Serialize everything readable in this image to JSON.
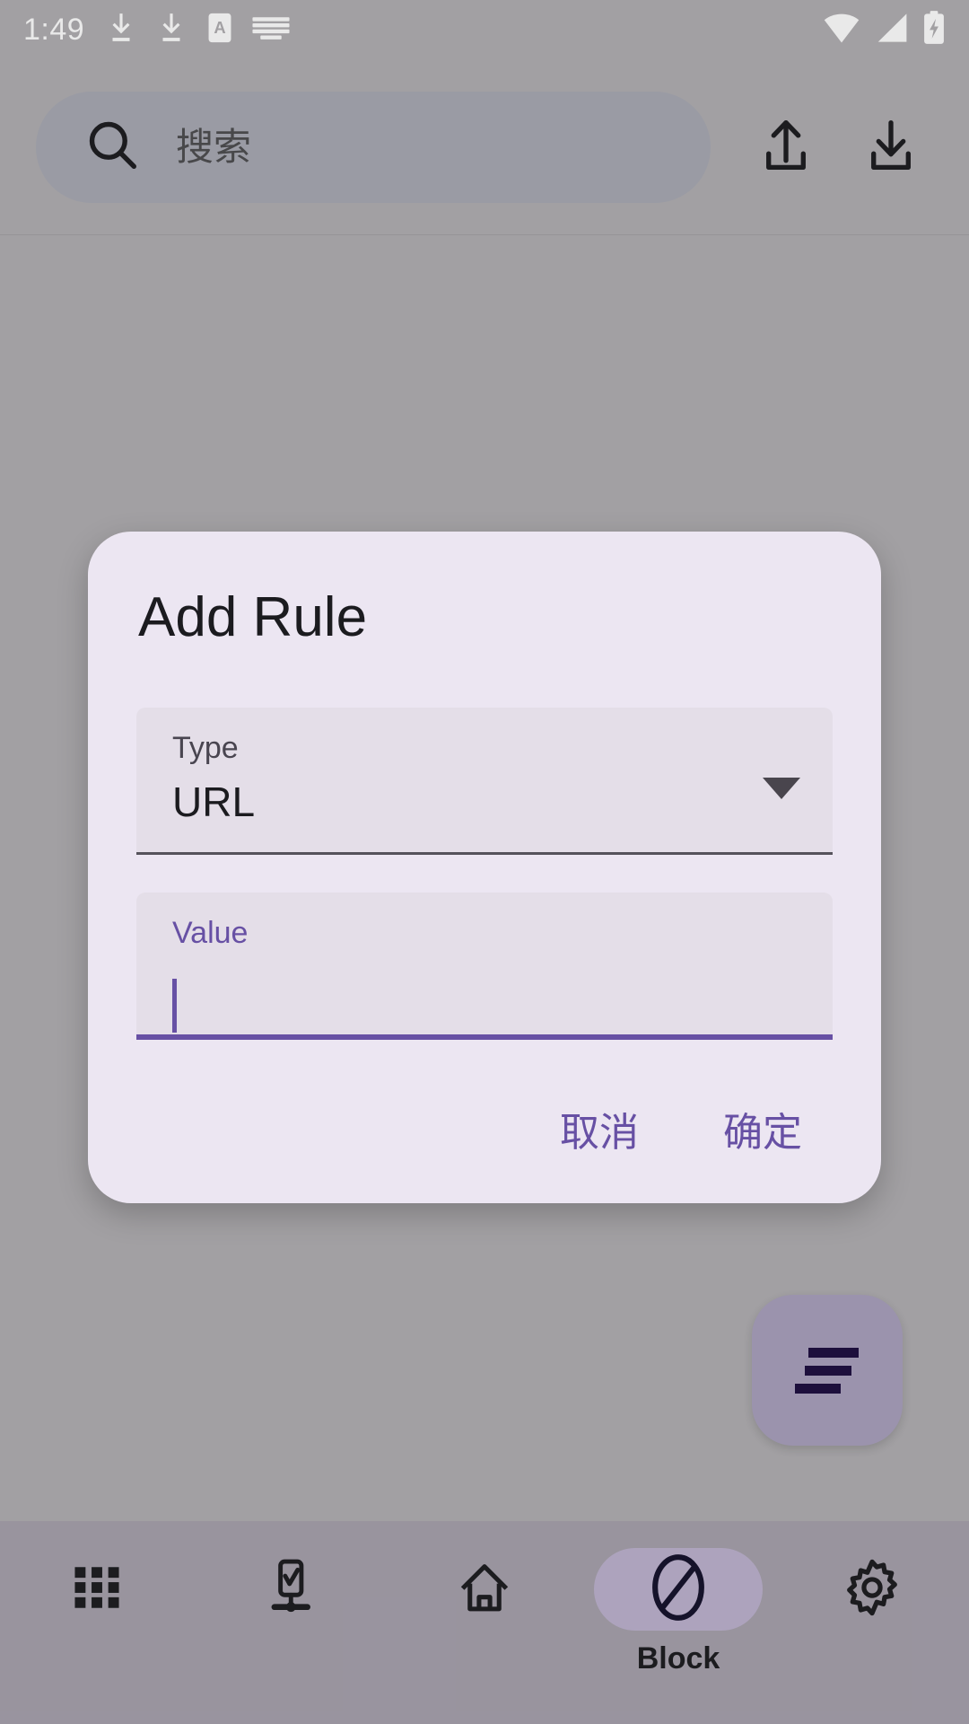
{
  "status_bar": {
    "clock": "1:49",
    "left_icons": [
      "download-icon",
      "download-icon",
      "font-size-icon",
      "keyboard-icon"
    ],
    "right_icons": [
      "wifi-icon",
      "cellular-signal-icon",
      "battery-charging-icon"
    ]
  },
  "top_bar": {
    "search_placeholder": "搜索",
    "search_value": "",
    "upload_icon": "upload-icon",
    "download_icon": "download-icon"
  },
  "fab": {
    "icon": "sort-lines-icon"
  },
  "dialog": {
    "title": "Add Rule",
    "type_field": {
      "label": "Type",
      "value": "URL",
      "dropdown_icon": "chevron-down-icon",
      "options": [
        "URL"
      ]
    },
    "value_field": {
      "label": "Value",
      "value": "",
      "placeholder": ""
    },
    "cancel_label": "取消",
    "confirm_label": "确定"
  },
  "bottom_nav": {
    "items": [
      {
        "label": "",
        "icon": "apps-grid-icon",
        "selected": false
      },
      {
        "label": "",
        "icon": "device-check-icon",
        "selected": false
      },
      {
        "label": "",
        "icon": "home-icon",
        "selected": false
      },
      {
        "label": "Block",
        "icon": "block-slash-circle-icon",
        "selected": true
      },
      {
        "label": "",
        "icon": "gear-icon",
        "selected": false
      }
    ]
  },
  "colors": {
    "accent_purple": "#6750a4",
    "dialog_surface": "#ece6f2",
    "field_surface": "#e4dee8",
    "scrim_gray": "#b0aeb1",
    "nav_bar": "#a6a1ac",
    "selected_pill": "#bdb2ce",
    "fab": "#a9a0bd"
  }
}
